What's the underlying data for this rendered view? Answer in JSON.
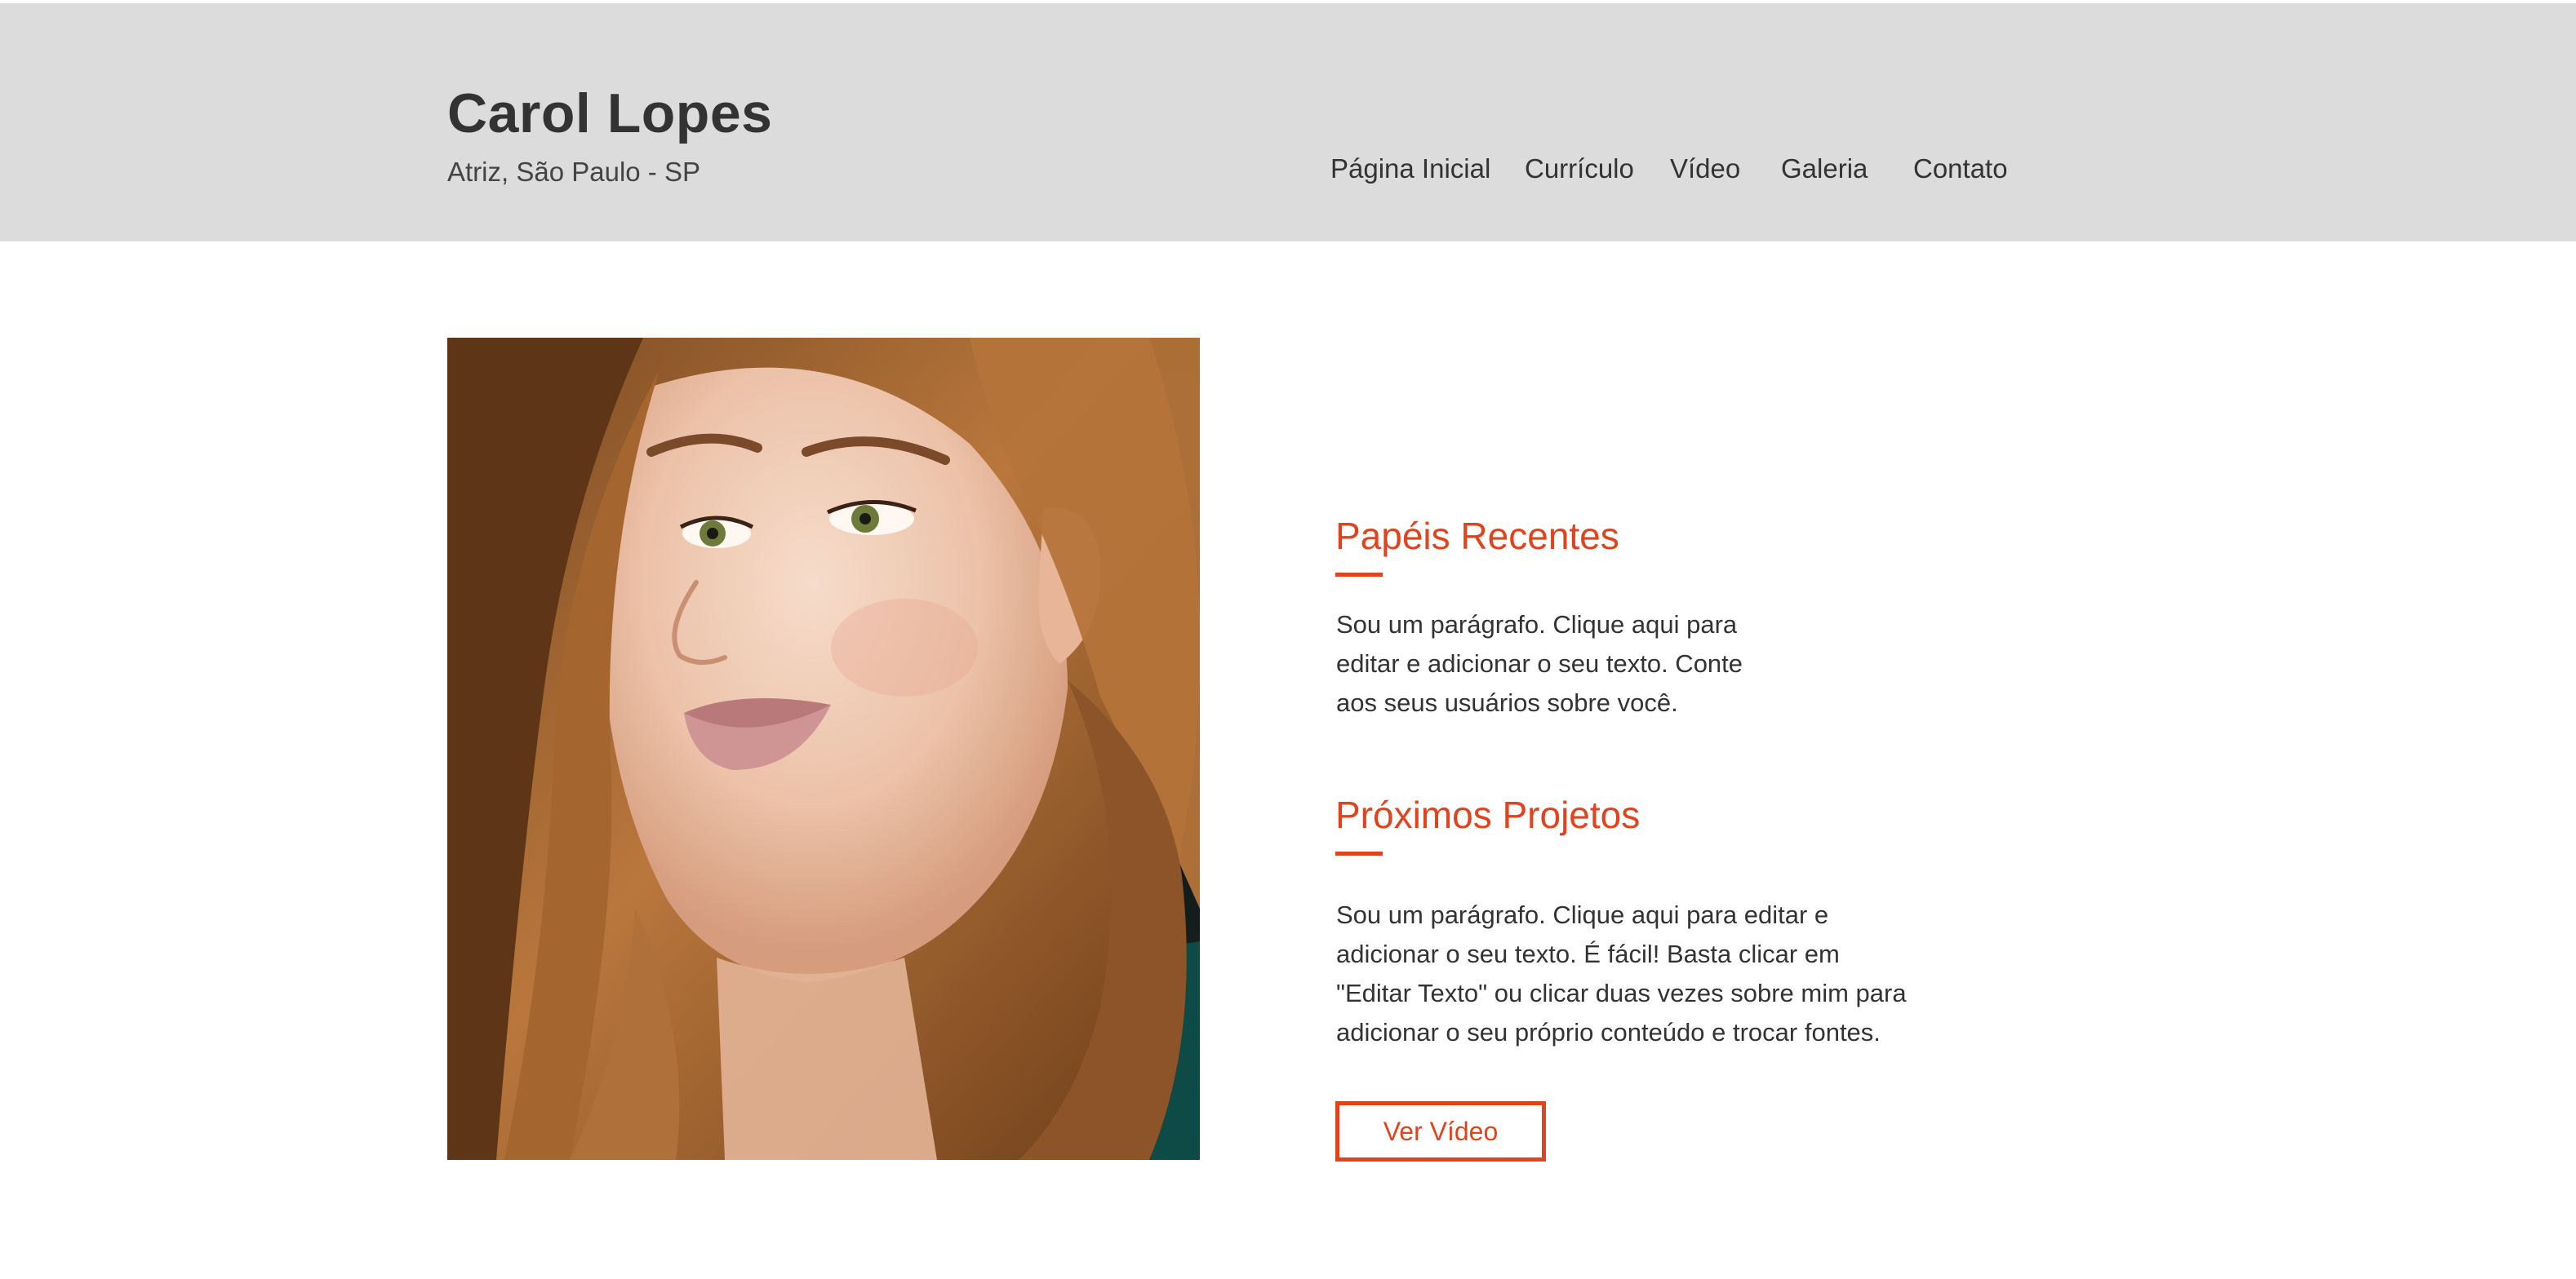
{
  "header": {
    "title": "Carol Lopes",
    "subtitle": "Atriz, São Paulo - SP"
  },
  "nav": {
    "items": [
      {
        "label": "Página Inicial"
      },
      {
        "label": "Currículo"
      },
      {
        "label": "Vídeo"
      },
      {
        "label": "Galeria"
      },
      {
        "label": "Contato"
      }
    ]
  },
  "main": {
    "photo": {
      "description_icon": "portrait-photo"
    },
    "sections": [
      {
        "title": "Papéis Recentes",
        "lines": [
          "Sou um parágrafo. Clique aqui para",
          "editar e adicionar o seu texto. Conte",
          "aos seus usuários sobre você."
        ]
      },
      {
        "title": "Próximos Projetos",
        "lines": [
          "Sou um parágrafo. Clique aqui para editar e",
          "adicionar o seu texto. É fácil! Basta clicar em",
          "\"Editar Texto\" ou clicar duas vezes sobre mim para",
          "adicionar o seu próprio conteúdo e trocar fontes."
        ]
      }
    ],
    "button_label": "Ver Vídeo"
  },
  "colors": {
    "header_bg": "#dcdcdc",
    "accent": "#e1441d",
    "text": "#333333"
  }
}
